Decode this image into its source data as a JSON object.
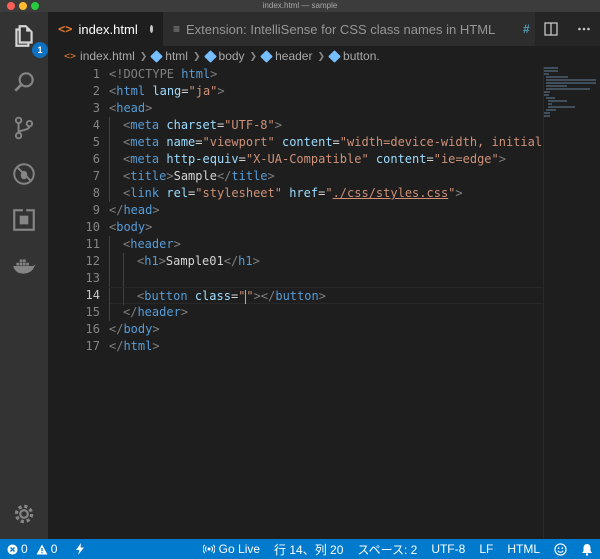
{
  "window": {
    "title": "index.html — sample"
  },
  "activity_bar": {
    "explorer_badge": "1",
    "items": [
      "files-icon",
      "search-icon",
      "source-control-icon",
      "debug-icon",
      "extensions-icon",
      "docker-icon"
    ],
    "settings": "gear-icon"
  },
  "tabs": [
    {
      "label": "index.html",
      "icon": "<>",
      "modified": true
    },
    {
      "label": "Extension: IntelliSense for CSS class names in HTML",
      "icon": "≡"
    },
    {
      "label": "s",
      "icon": "#"
    }
  ],
  "breadcrumb": {
    "file": "index.html",
    "path": [
      "html",
      "body",
      "header",
      "button."
    ]
  },
  "editor": {
    "current_line": 14,
    "lines": [
      {
        "n": "1",
        "tokens": [
          {
            "t": "<!DOCTYPE ",
            "c": "tg"
          },
          {
            "t": "html",
            "c": "tn"
          },
          {
            "t": ">",
            "c": "tg"
          }
        ]
      },
      {
        "n": "2",
        "tokens": [
          {
            "t": "<",
            "c": "tg"
          },
          {
            "t": "html",
            "c": "tn"
          },
          {
            "t": " lang",
            "c": "at"
          },
          {
            "t": "=",
            "c": "tx"
          },
          {
            "t": "\"ja\"",
            "c": "st"
          },
          {
            "t": ">",
            "c": "tg"
          }
        ]
      },
      {
        "n": "3",
        "tokens": [
          {
            "t": "<",
            "c": "tg"
          },
          {
            "t": "head",
            "c": "tn"
          },
          {
            "t": ">",
            "c": "tg"
          }
        ]
      },
      {
        "n": "4",
        "indent": 1,
        "tokens": [
          {
            "t": "<",
            "c": "tg"
          },
          {
            "t": "meta",
            "c": "tn"
          },
          {
            "t": " charset",
            "c": "at"
          },
          {
            "t": "=",
            "c": "tx"
          },
          {
            "t": "\"UTF-8\"",
            "c": "st"
          },
          {
            "t": ">",
            "c": "tg"
          }
        ]
      },
      {
        "n": "5",
        "indent": 1,
        "tokens": [
          {
            "t": "<",
            "c": "tg"
          },
          {
            "t": "meta",
            "c": "tn"
          },
          {
            "t": " name",
            "c": "at"
          },
          {
            "t": "=",
            "c": "tx"
          },
          {
            "t": "\"viewport\"",
            "c": "st"
          },
          {
            "t": " content",
            "c": "at"
          },
          {
            "t": "=",
            "c": "tx"
          },
          {
            "t": "\"width=device-width, initial-sca",
            "c": "st"
          }
        ]
      },
      {
        "n": "6",
        "indent": 1,
        "tokens": [
          {
            "t": "<",
            "c": "tg"
          },
          {
            "t": "meta",
            "c": "tn"
          },
          {
            "t": " http-equiv",
            "c": "at"
          },
          {
            "t": "=",
            "c": "tx"
          },
          {
            "t": "\"X-UA-Compatible\"",
            "c": "st"
          },
          {
            "t": " content",
            "c": "at"
          },
          {
            "t": "=",
            "c": "tx"
          },
          {
            "t": "\"ie=edge\"",
            "c": "st"
          },
          {
            "t": ">",
            "c": "tg"
          }
        ]
      },
      {
        "n": "7",
        "indent": 1,
        "tokens": [
          {
            "t": "<",
            "c": "tg"
          },
          {
            "t": "title",
            "c": "tn"
          },
          {
            "t": ">",
            "c": "tg"
          },
          {
            "t": "Sample",
            "c": "tx"
          },
          {
            "t": "</",
            "c": "tg"
          },
          {
            "t": "title",
            "c": "tn"
          },
          {
            "t": ">",
            "c": "tg"
          }
        ]
      },
      {
        "n": "8",
        "indent": 1,
        "tokens": [
          {
            "t": "<",
            "c": "tg"
          },
          {
            "t": "link",
            "c": "tn"
          },
          {
            "t": " rel",
            "c": "at"
          },
          {
            "t": "=",
            "c": "tx"
          },
          {
            "t": "\"stylesheet\"",
            "c": "st"
          },
          {
            "t": " href",
            "c": "at"
          },
          {
            "t": "=",
            "c": "tx"
          },
          {
            "t": "\"",
            "c": "st"
          },
          {
            "t": "./css/styles.css",
            "c": "st ul"
          },
          {
            "t": "\"",
            "c": "st"
          },
          {
            "t": ">",
            "c": "tg"
          }
        ]
      },
      {
        "n": "9",
        "tokens": [
          {
            "t": "</",
            "c": "tg"
          },
          {
            "t": "head",
            "c": "tn"
          },
          {
            "t": ">",
            "c": "tg"
          }
        ]
      },
      {
        "n": "10",
        "tokens": [
          {
            "t": "<",
            "c": "tg"
          },
          {
            "t": "body",
            "c": "tn"
          },
          {
            "t": ">",
            "c": "tg"
          }
        ]
      },
      {
        "n": "11",
        "indent": 1,
        "tokens": [
          {
            "t": "<",
            "c": "tg"
          },
          {
            "t": "header",
            "c": "tn"
          },
          {
            "t": ">",
            "c": "tg"
          }
        ]
      },
      {
        "n": "12",
        "indent": 2,
        "tokens": [
          {
            "t": "<",
            "c": "tg"
          },
          {
            "t": "h1",
            "c": "tn"
          },
          {
            "t": ">",
            "c": "tg"
          },
          {
            "t": "Sample01",
            "c": "tx"
          },
          {
            "t": "</",
            "c": "tg"
          },
          {
            "t": "h1",
            "c": "tn"
          },
          {
            "t": ">",
            "c": "tg"
          }
        ]
      },
      {
        "n": "13",
        "indent": 2,
        "tokens": []
      },
      {
        "n": "14",
        "indent": 2,
        "cursor_after": 4,
        "tokens": [
          {
            "t": "<",
            "c": "tg"
          },
          {
            "t": "button",
            "c": "tn"
          },
          {
            "t": " class",
            "c": "at"
          },
          {
            "t": "=",
            "c": "tx"
          },
          {
            "t": "\"",
            "c": "st"
          },
          {
            "t": "\"",
            "c": "st"
          },
          {
            "t": "></",
            "c": "tg"
          },
          {
            "t": "button",
            "c": "tn"
          },
          {
            "t": ">",
            "c": "tg"
          }
        ]
      },
      {
        "n": "15",
        "indent": 1,
        "tokens": [
          {
            "t": "</",
            "c": "tg"
          },
          {
            "t": "header",
            "c": "tn"
          },
          {
            "t": ">",
            "c": "tg"
          }
        ]
      },
      {
        "n": "16",
        "tokens": [
          {
            "t": "</",
            "c": "tg"
          },
          {
            "t": "body",
            "c": "tn"
          },
          {
            "t": ">",
            "c": "tg"
          }
        ]
      },
      {
        "n": "17",
        "tokens": [
          {
            "t": "</",
            "c": "tg"
          },
          {
            "t": "html",
            "c": "tn"
          },
          {
            "t": ">",
            "c": "tg"
          }
        ]
      }
    ]
  },
  "status_bar": {
    "errors": "0",
    "warnings": "0",
    "go_live": "Go Live",
    "position": "行 14、列 20",
    "spaces": "スペース: 2",
    "encoding": "UTF-8",
    "eol": "LF",
    "language": "HTML"
  },
  "colors": {
    "accent": "#007acc",
    "badge": "#0e70c0",
    "html_icon": "#e37933"
  }
}
